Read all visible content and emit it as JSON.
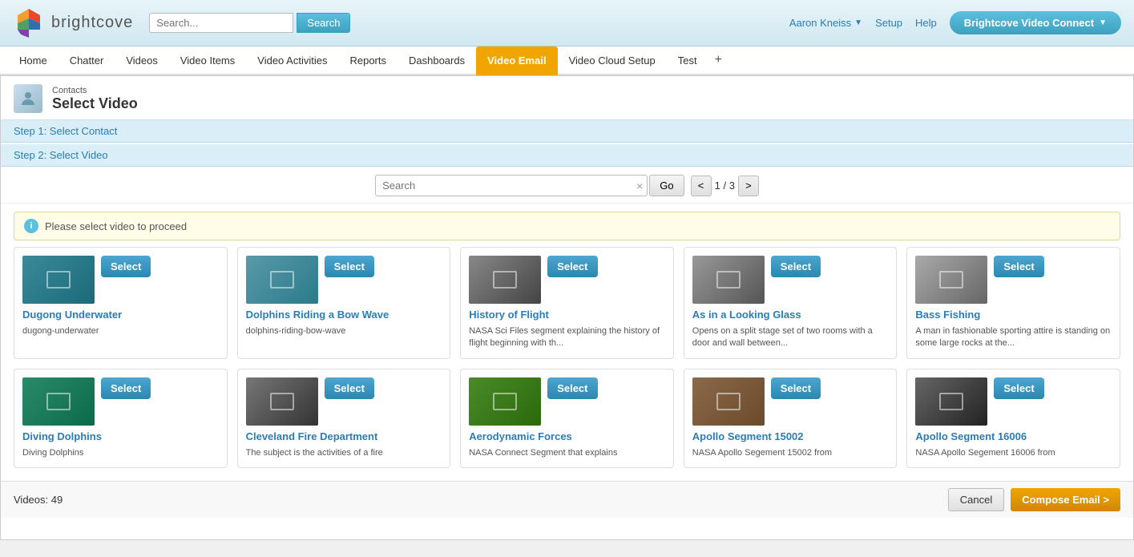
{
  "header": {
    "logo_alt": "Brightcove",
    "search_placeholder": "Search...",
    "search_button": "Search",
    "user_name": "Aaron Kneiss",
    "setup_label": "Setup",
    "help_label": "Help",
    "connect_button": "Brightcove Video Connect",
    "chevron": "▼"
  },
  "nav": {
    "items": [
      {
        "label": "Home",
        "active": false
      },
      {
        "label": "Chatter",
        "active": false
      },
      {
        "label": "Videos",
        "active": false
      },
      {
        "label": "Video Items",
        "active": false
      },
      {
        "label": "Video Activities",
        "active": false
      },
      {
        "label": "Reports",
        "active": false
      },
      {
        "label": "Dashboards",
        "active": false
      },
      {
        "label": "Video Email",
        "active": true
      },
      {
        "label": "Video Cloud Setup",
        "active": false
      },
      {
        "label": "Test",
        "active": false
      }
    ],
    "plus": "+"
  },
  "breadcrumb": {
    "parent": "Contacts",
    "title": "Select Video"
  },
  "steps": {
    "step1": "Step 1: Select Contact",
    "step2": "Step 2: Select Video"
  },
  "search": {
    "placeholder": "Search",
    "go_button": "Go",
    "clear": "×",
    "current_page": "1",
    "total_pages": "3",
    "prev": "<",
    "next": ">"
  },
  "info_bar": {
    "message": "Please select video to proceed",
    "icon": "i"
  },
  "videos": [
    {
      "title": "Dugong Underwater",
      "description": "dugong-underwater",
      "thumb_class": "thumb-dugong",
      "select_label": "Select"
    },
    {
      "title": "Dolphins Riding a Bow Wave",
      "description": "dolphins-riding-bow-wave",
      "thumb_class": "thumb-dolphins",
      "select_label": "Select"
    },
    {
      "title": "History of Flight",
      "description": "NASA Sci Files segment explaining the history of flight beginning with th...",
      "thumb_class": "thumb-flight",
      "select_label": "Select"
    },
    {
      "title": "As in a Looking Glass",
      "description": "Opens on a split stage set of two rooms with a door and wall between...",
      "thumb_class": "thumb-looking",
      "select_label": "Select"
    },
    {
      "title": "Bass Fishing",
      "description": "A man in fashionable sporting attire is standing on some large rocks at the...",
      "thumb_class": "thumb-bass",
      "select_label": "Select"
    },
    {
      "title": "Diving Dolphins",
      "description": "Diving Dolphins",
      "thumb_class": "thumb-diving",
      "select_label": "Select"
    },
    {
      "title": "Cleveland Fire Department",
      "description": "The subject is the activities of a fire",
      "thumb_class": "thumb-cleveland",
      "select_label": "Select"
    },
    {
      "title": "Aerodynamic Forces",
      "description": "NASA Connect Segment that explains",
      "thumb_class": "thumb-aero",
      "select_label": "Select"
    },
    {
      "title": "Apollo Segment 15002",
      "description": "NASA Apollo Segement 15002 from",
      "thumb_class": "thumb-apollo15",
      "select_label": "Select"
    },
    {
      "title": "Apollo Segment 16006",
      "description": "NASA Apollo Segement 16006 from",
      "thumb_class": "thumb-apollo16",
      "select_label": "Select"
    }
  ],
  "footer": {
    "videos_label": "Videos:",
    "videos_count": "49",
    "cancel_label": "Cancel",
    "compose_label": "Compose Email >"
  }
}
